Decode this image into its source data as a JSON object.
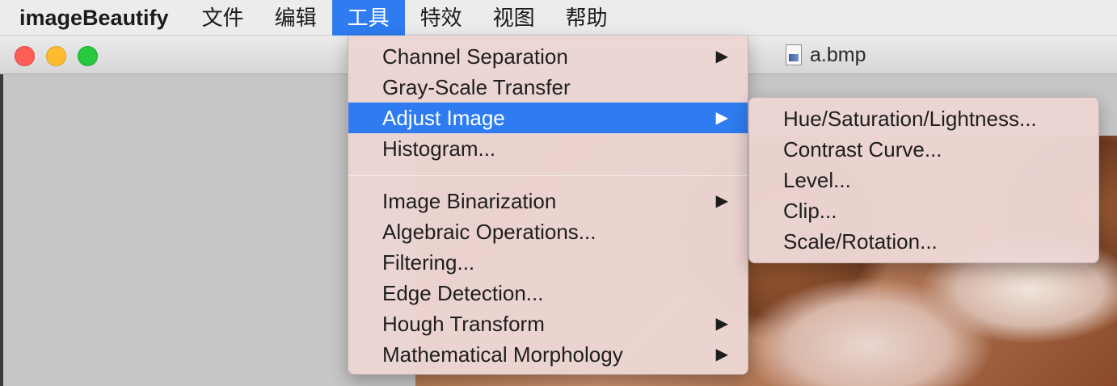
{
  "menubar": {
    "app_name": "imageBeautify",
    "items": [
      {
        "label": "文件"
      },
      {
        "label": "编辑"
      },
      {
        "label": "工具",
        "active": true
      },
      {
        "label": "特效"
      },
      {
        "label": "视图"
      },
      {
        "label": "帮助"
      }
    ]
  },
  "window": {
    "title": "a.bmp",
    "title_icon": "bmp-file-icon",
    "traffic_lights": {
      "close": "#fd5e56",
      "minimize": "#fdbc2e",
      "zoom": "#28c840"
    }
  },
  "tools_menu": {
    "group1": [
      {
        "label": "Channel Separation",
        "submenu": true
      },
      {
        "label": "Gray-Scale Transfer",
        "submenu": false
      },
      {
        "label": "Adjust Image",
        "submenu": true,
        "highlighted": true
      },
      {
        "label": "Histogram...",
        "submenu": false
      }
    ],
    "group2": [
      {
        "label": "Image Binarization",
        "submenu": true
      },
      {
        "label": "Algebraic Operations...",
        "submenu": false
      },
      {
        "label": "Filtering...",
        "submenu": false
      },
      {
        "label": "Edge Detection...",
        "submenu": false
      },
      {
        "label": "Hough Transform",
        "submenu": true
      },
      {
        "label": "Mathematical Morphology",
        "submenu": true
      }
    ],
    "submenu_arrow": "▶"
  },
  "adjust_image_submenu": {
    "items": [
      {
        "label": "Hue/Saturation/Lightness..."
      },
      {
        "label": "Contrast Curve..."
      },
      {
        "label": "Level..."
      },
      {
        "label": "Clip..."
      },
      {
        "label": "Scale/Rotation..."
      }
    ]
  },
  "colors": {
    "highlight": "#2e7cf0",
    "menu_background": "#ecd6d4"
  }
}
